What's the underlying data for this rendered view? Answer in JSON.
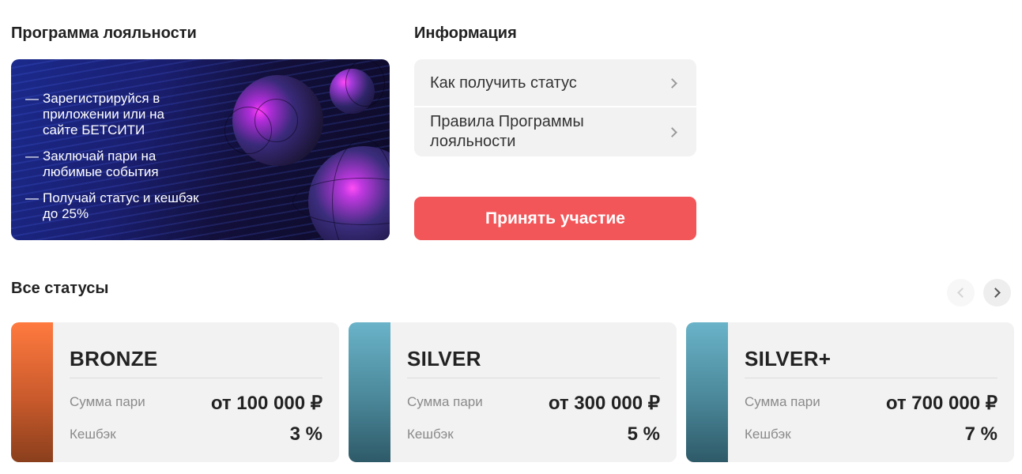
{
  "loyalty": {
    "title": "Программа лояльности",
    "banner": {
      "items": [
        "Зарегистрируйся в приложении или на сайте БЕТСИТИ",
        "Заключай пари на любимые события",
        "Получай статус и кешбэк до 25%"
      ]
    }
  },
  "info": {
    "title": "Информация",
    "links": [
      "Как получить статус",
      "Правила Программы лояльности"
    ],
    "cta_label": "Принять участие"
  },
  "statuses": {
    "title": "Все статусы",
    "cards": [
      {
        "name": "BRONZE",
        "sum_label": "Сумма пари",
        "sum_value": "от 100 000 ₽",
        "cashback_label": "Кешбэк",
        "cashback_value": "3 %",
        "color": "#e8692f"
      },
      {
        "name": "SILVER",
        "sum_label": "Сумма пари",
        "sum_value": "от 300 000 ₽",
        "cashback_label": "Кешбэк",
        "cashback_value": "5 %",
        "color": "#4a8799"
      },
      {
        "name": "SILVER+",
        "sum_label": "Сумма пари",
        "sum_value": "от 700 000 ₽",
        "cashback_label": "Кешбэк",
        "cashback_value": "7 %",
        "color": "#4a8799"
      }
    ]
  },
  "colors": {
    "accent": "#f25659",
    "panel": "#f2f2f2"
  },
  "icons": {
    "link_arrow": "chevron-right-icon",
    "prev": "chevron-left-icon",
    "next": "chevron-right-icon"
  }
}
